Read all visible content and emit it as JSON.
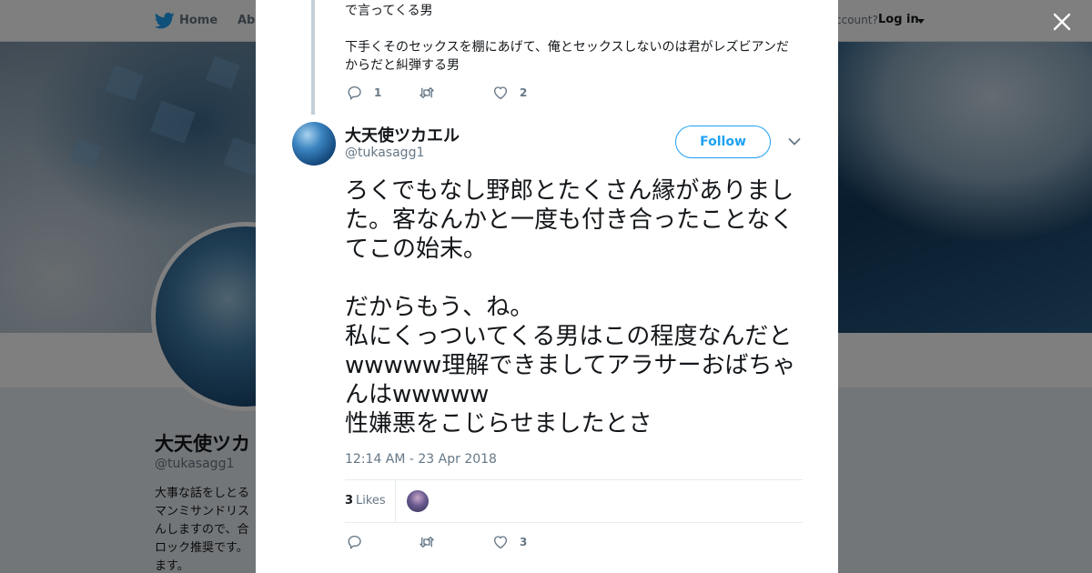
{
  "nav": {
    "home": "Home",
    "about": "Abo",
    "account_prompt": "ccount?",
    "login": "Log in"
  },
  "profile": {
    "name": "大天使ツカ",
    "handle": "@tukasagg1",
    "bio_lines": [
      "大事な話をしとる",
      "マンミサンドリス",
      "んしますので、合",
      "ロック推奨です。",
      "ます。"
    ]
  },
  "previous_tweet": {
    "lines": [
      "で言ってくる男",
      "",
      "下手くそのセックスを棚にあげて、俺とセックスしないのは君がレズビアンだからだと糾弾する男"
    ],
    "reply_count": "1",
    "like_count": "2"
  },
  "tweet": {
    "display_name": "大天使ツカエル",
    "handle": "@tukasagg1",
    "follow_label": "Follow",
    "text": "ろくでもなし野郎とたくさん縁がありました。客なんかと一度も付き合ったことなくてこの始末。\n\nだからもう、ね。\n私にくっついてくる男はこの程度なんだとwwwww理解できましてアラサーおばちゃんはwwwww\n性嫌悪をこじらせましたとさ",
    "timestamp": "12:14 AM - 23 Apr 2018",
    "likes_count": "3",
    "likes_label": "Likes",
    "action_like_count": "3"
  },
  "colors": {
    "accent": "#1da1f2",
    "muted": "#657786",
    "text": "#14171a"
  }
}
